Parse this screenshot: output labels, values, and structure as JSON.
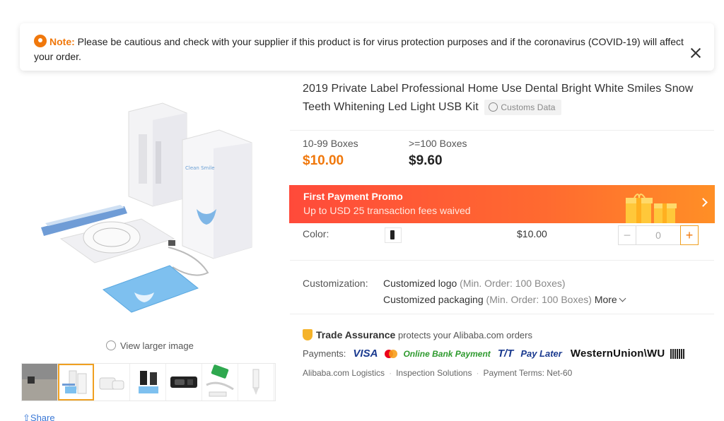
{
  "notice": {
    "label": "Note:",
    "text": " Please be cautious and check with your supplier if this product is for virus protection purposes and if the coronavirus (COVID-19) will affect your order."
  },
  "gallery": {
    "view_larger": "View larger image",
    "share": "Share",
    "thumb_count": 7,
    "active_thumb": 2
  },
  "product": {
    "title": "2019 Private Label Professional Home Use Dental Bright White Smiles Snow Teeth Whitening Led Light USB Kit",
    "customs_badge": "Customs Data",
    "box_text": "Clean Smile"
  },
  "pricing": [
    {
      "qty": "10-99 Boxes",
      "price": "$10.00"
    },
    {
      "qty": ">=100 Boxes",
      "price": "$9.60"
    }
  ],
  "promo": {
    "title": "First Payment Promo",
    "subtitle": "Up to USD 25 transaction fees waived"
  },
  "variant": {
    "color_label": "Color:",
    "price": "$10.00",
    "minus": "−",
    "quantity": "0",
    "plus": "+"
  },
  "customization": {
    "label": "Customization:",
    "logo": "Customized logo",
    "logo_min": " (Min. Order: 100 Boxes)",
    "packaging": "Customized packaging",
    "packaging_min": " (Min. Order: 100 Boxes)",
    "more": "More"
  },
  "trade": {
    "title": "Trade Assurance",
    "text": "protects your Alibaba.com orders"
  },
  "payments": {
    "label": "Payments:",
    "visa": "VISA",
    "online_bank": "Online Bank Payment",
    "tt": "T/T",
    "pay_later": "Pay Later",
    "western_union": "WesternUnion\\WU"
  },
  "services": [
    "Alibaba.com Logistics",
    "Inspection Solutions",
    "Payment Terms: Net-60"
  ],
  "colors": {
    "accent": "#f0780c",
    "promo_start": "#ff4a3a",
    "promo_end": "#ff8f26",
    "link": "#3a78d6"
  }
}
